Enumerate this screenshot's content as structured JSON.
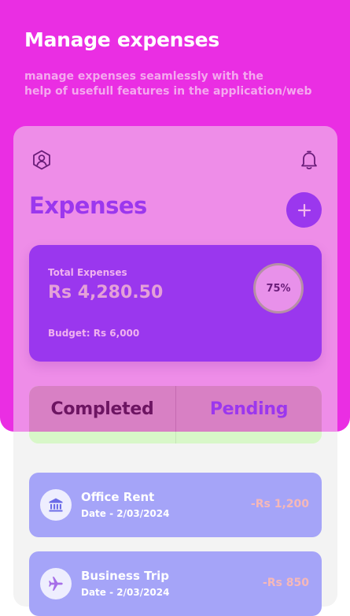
{
  "header": {
    "title": "Manage expenses",
    "subtitle_line1": "manage expenses seamlessly with the",
    "subtitle_line2": "help of usefull features in the application/web"
  },
  "toolbar": {
    "profile_icon": "user-hexagon-icon",
    "notification_icon": "bell-icon"
  },
  "expenses": {
    "title": "Expenses",
    "add_icon": "plus-icon"
  },
  "summary": {
    "label": "Total Expenses",
    "amount": "Rs 4,280.50",
    "budget": "Budget: Rs 6,000",
    "progress_label": "75%",
    "progress_fraction": 0.75
  },
  "tabs": [
    {
      "label": "Completed",
      "selected": true
    },
    {
      "label": "Pending",
      "selected": false
    }
  ],
  "transactions": [
    {
      "title": "Office Rent",
      "date": "Date - 2/03/2024",
      "amount": "-Rs 1,200",
      "icon": "bank-icon"
    },
    {
      "title": "Business Trip",
      "date": "Date - 2/03/2024",
      "amount": "-Rs 850",
      "icon": "airplane-icon"
    }
  ],
  "colors": {
    "hero": "#ea2ee3",
    "accent": "#9b37ee",
    "transaction_card": "#a5a4f8",
    "tab_strip": "#d8f7c8"
  }
}
